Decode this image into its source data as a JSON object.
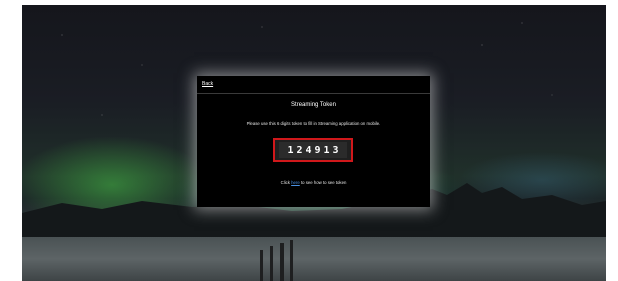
{
  "modal": {
    "back_label": "Back",
    "title": "Streaming Token",
    "description": "Please use this 6 digits token to fill in Streaming application on mobile.",
    "token": "124913",
    "help_prefix": "Click",
    "help_link": "here",
    "help_suffix": "to see how to see token"
  },
  "colors": {
    "modal_background": "#000000",
    "token_border": "#d0181b",
    "link": "#4a90e2"
  }
}
